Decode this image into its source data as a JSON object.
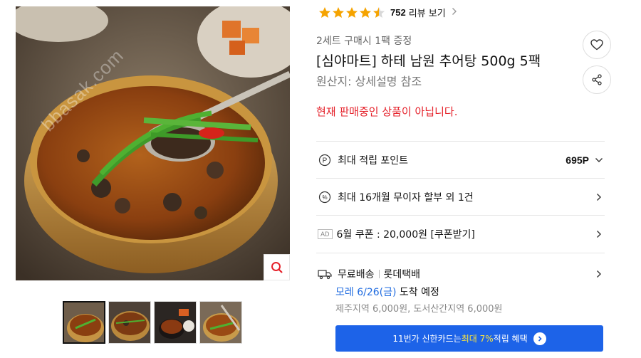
{
  "gallery": {
    "watermark": "bbasak.com",
    "thumbnail_count": 4
  },
  "rating": {
    "score": 4.5,
    "max": 5,
    "review_count": "752",
    "review_label": "리뷰 보기"
  },
  "product": {
    "promo": "2세트 구매시 1팩 증정",
    "title": "[심야마트] 하테 남원 추어탕 500g 5팩",
    "origin": "원산지:  상세설명 참조",
    "status": "현재 판매중인 상품이 아닙니다."
  },
  "benefits": {
    "points_label": "최대 적립 포인트",
    "points_value": "695P",
    "installment_label": "최대 16개월 무이자 할부 외 1건",
    "ad_badge": "AD",
    "coupon_label": "6월 쿠폰 : 20,000원 [쿠폰받기]"
  },
  "shipping": {
    "fee": "무료배송",
    "carrier": "롯데택배",
    "date": "모레 6/26(금)",
    "date_suffix": " 도착 예정",
    "extra": "제주지역 6,000원, 도서산간지역 6,000원"
  },
  "card_banner": {
    "prefix": "11번가 신한카드는 ",
    "highlight": "최대 7%",
    "suffix": " 적립 혜택"
  },
  "colors": {
    "accent_blue": "#1d63e8",
    "status_red": "#e5222b",
    "star": "#f5a300"
  },
  "icons": {
    "zoom": "magnifier-icon",
    "wish": "heart-icon",
    "share": "share-icon",
    "points": "point-p-icon",
    "installment": "percent-icon",
    "shipping": "truck-icon"
  }
}
